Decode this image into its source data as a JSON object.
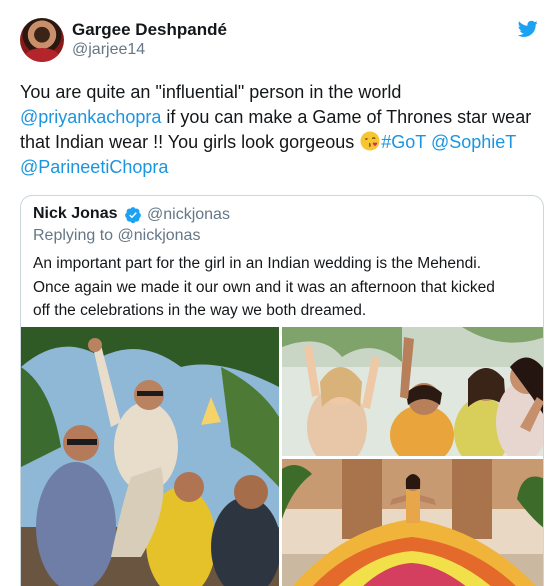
{
  "tweet": {
    "author": {
      "name": "Gargee Deshpandé",
      "handle": "@jarjee14"
    },
    "icons": {
      "platform": "twitter-bird-icon",
      "emoji": "face-blowing-kiss-emoji",
      "verified": "verified-badge-icon"
    },
    "colors": {
      "link": "#1b95e0",
      "text": "#14171a",
      "muted": "#657786",
      "border": "#ccd6dd",
      "verified": "#1da1f2"
    },
    "text": {
      "line1": "You are quite an \"influential\" person in the world",
      "line2_mention": "@priyankachopra",
      "line2_rest": " if you can make a Game of Thrones star wear",
      "line3_text": "that Indian wear !! You girls look gorgeous ",
      "line3_hashtag": "#GoT",
      "line3_space": " ",
      "line3_mention": "@SophieT",
      "line4_mention": "@ParineetiChopra"
    },
    "quoted": {
      "name": "Nick Jonas",
      "handle": "@nickjonas",
      "reply_context": "Replying to @nickjonas",
      "text_lines": [
        "An important part for the girl in an Indian wedding is the Mehendi.",
        "Once again we made it our own and it was an afternoon that kicked",
        "off the celebrations in the way we both dreamed."
      ]
    }
  }
}
